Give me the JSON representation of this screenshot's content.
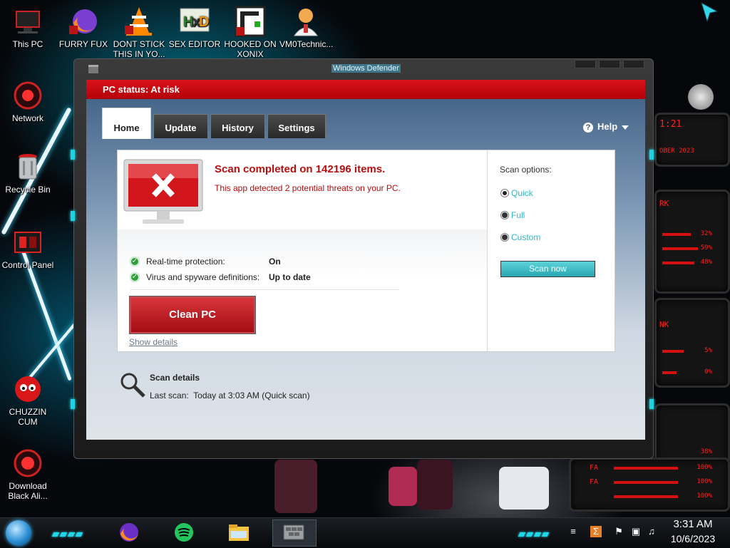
{
  "desktop": {
    "icons": [
      {
        "label": "This PC",
        "icon": "pc-icon"
      },
      {
        "label": "FURRY FUX",
        "icon": "firefox-shortcut-icon"
      },
      {
        "label": "DONT STICK THIS IN YO...",
        "icon": "vlc-cone-icon"
      },
      {
        "label": "SEX EDITOR",
        "icon": "hxd-editor-icon"
      },
      {
        "label": "HOOKED ON XONIX",
        "icon": "xonix-game-icon"
      },
      {
        "label": "VM0Technic...",
        "icon": "doctor-person-icon"
      },
      {
        "label": "Network",
        "icon": "network-orb-icon"
      },
      {
        "label": "Recycle Bin",
        "icon": "recycle-bin-icon"
      },
      {
        "label": "Control Panel",
        "icon": "control-panel-icon"
      },
      {
        "label": "CHUZZIN CUM",
        "icon": "red-chuzzle-icon"
      },
      {
        "label": "Download Black Ali...",
        "icon": "alien-orb-icon"
      }
    ]
  },
  "gadgets": {
    "time_fragment": "1:21",
    "date_fragment": "OBER 2023",
    "cpu_values": [
      "32%",
      "59%",
      "48%"
    ],
    "disk_values": [
      "5%",
      "0%"
    ],
    "net_values": [
      "38%",
      "100%",
      "100%",
      "100%"
    ],
    "labels": [
      "RK",
      "NK",
      "FA",
      "FA"
    ]
  },
  "window": {
    "title": "Windows Defender",
    "status_text": "PC status: At risk",
    "tabs": [
      {
        "label": "Home",
        "active": true
      },
      {
        "label": "Update",
        "active": false
      },
      {
        "label": "History",
        "active": false
      },
      {
        "label": "Settings",
        "active": false
      }
    ],
    "help_label": "Help",
    "scan_result": {
      "headline": "Scan completed on 142196 items.",
      "subline": "This app detected 2 potential threats on your PC."
    },
    "protection": [
      {
        "label": "Real-time protection:",
        "value": "On"
      },
      {
        "label": "Virus and spyware definitions:",
        "value": "Up to date"
      }
    ],
    "clean_button": "Clean PC",
    "show_details": "Show details",
    "scan_options": {
      "title": "Scan options:",
      "options": [
        {
          "label": "Quick",
          "selected": true
        },
        {
          "label": "Full",
          "selected": false
        },
        {
          "label": "Custom",
          "selected": false
        }
      ],
      "scan_now": "Scan now"
    },
    "scan_details": {
      "title": "Scan details",
      "last_scan_label": "Last scan:",
      "last_scan_value": "Today at 3:03 AM (Quick scan)"
    }
  },
  "taskbar": {
    "apps": [
      "firefox-icon",
      "spotify-icon",
      "file-explorer-icon",
      "windows-defender-icon"
    ],
    "clock_time": "3:31 AM",
    "clock_date": "10/6/2023",
    "tray": [
      "language-icon",
      "flag-alert-icon",
      "network-icon",
      "volume-icon"
    ]
  },
  "colors": {
    "status_red": "#c8101a",
    "accent_teal": "#2ab8c5",
    "threat_text": "#b80e0e"
  }
}
